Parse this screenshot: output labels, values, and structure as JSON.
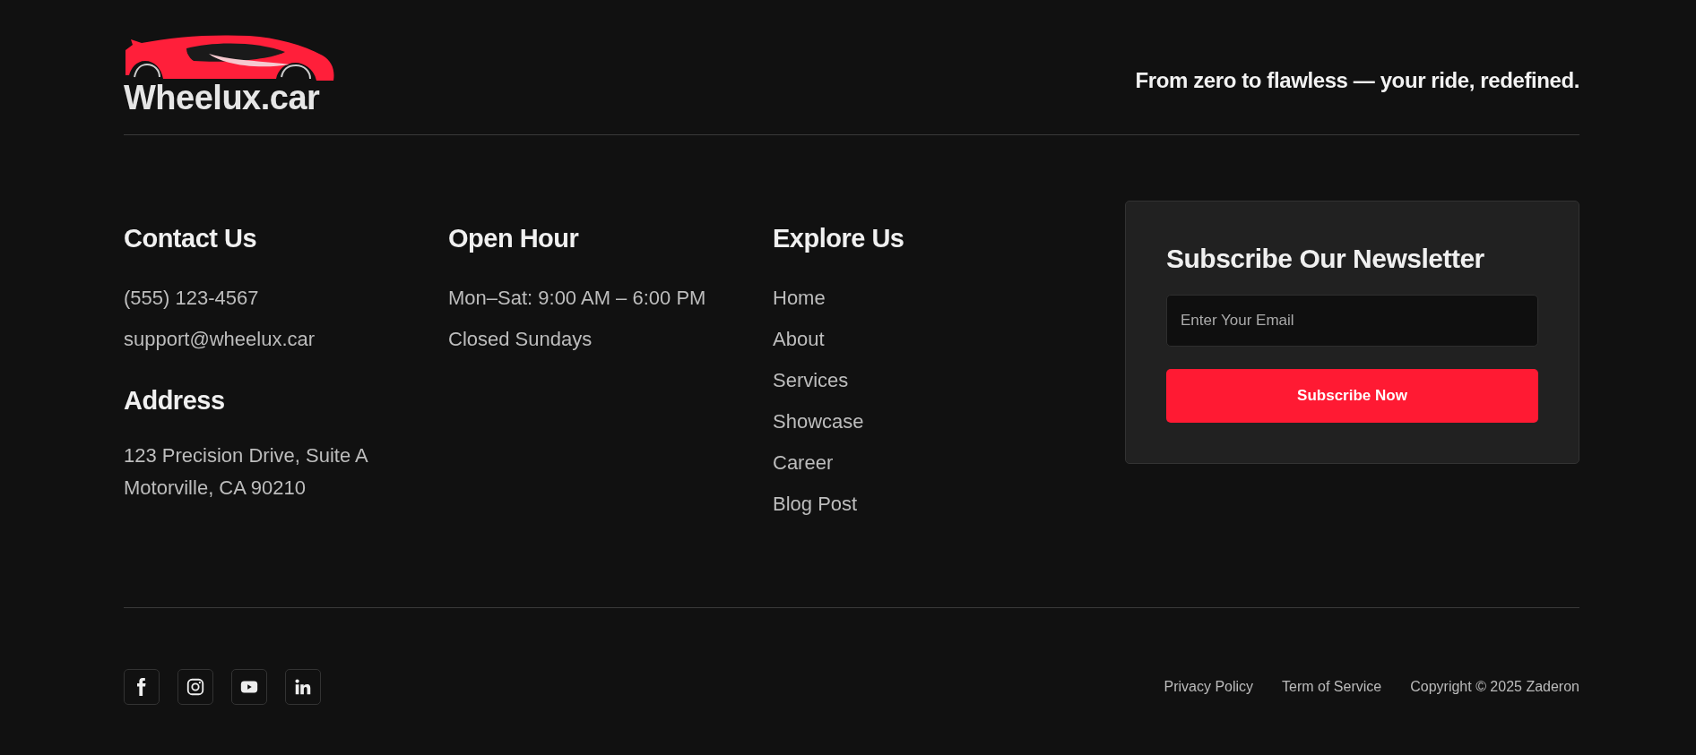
{
  "logo": {
    "text": "Wheelux.car"
  },
  "tagline": "From zero to flawless — your ride, redefined.",
  "columns": [
    {
      "groups": [
        {
          "heading": "Contact Us",
          "kind": "text",
          "items": [
            "(555) 123-4567",
            "support@wheelux.car"
          ]
        },
        {
          "heading": "Address",
          "kind": "address",
          "items": [
            "123 Precision Drive, Suite A",
            "Motorville, CA 90210"
          ]
        }
      ]
    },
    {
      "groups": [
        {
          "heading": "Open Hour",
          "kind": "text",
          "items": [
            "Mon–Sat: 9:00 AM – 6:00 PM",
            "Closed Sundays"
          ]
        }
      ]
    },
    {
      "groups": [
        {
          "heading": "Explore Us",
          "kind": "links",
          "items": [
            "Home",
            "About",
            "Services",
            "Showcase",
            "Career",
            "Blog Post"
          ]
        }
      ]
    }
  ],
  "newsletter": {
    "title": "Subscribe Our Newsletter",
    "placeholder": "Enter Your Email",
    "button": "Subscribe Now"
  },
  "social": [
    {
      "kind": "facebook"
    },
    {
      "kind": "instagram"
    },
    {
      "kind": "youtube"
    },
    {
      "kind": "linkedin"
    }
  ],
  "bottom_links": [
    "Privacy Policy",
    "Term of Service"
  ],
  "copyright": "Copyright © 2025 Zaderon"
}
